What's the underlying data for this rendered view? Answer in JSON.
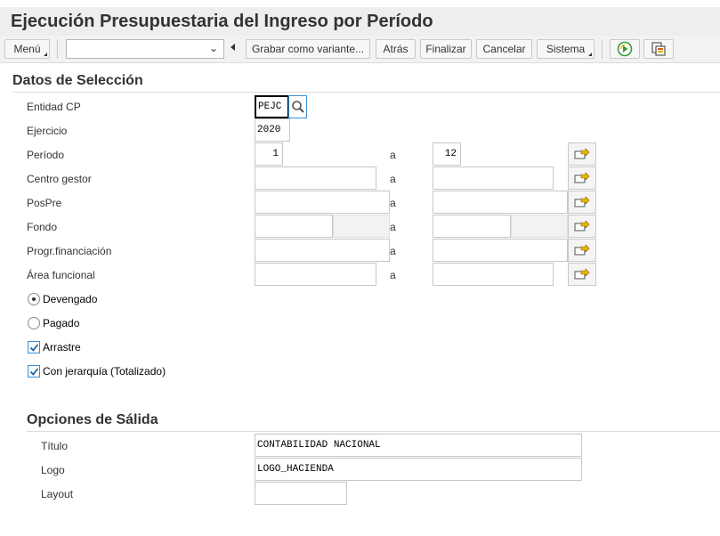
{
  "window": {
    "title": "Ejecución Presupuestaria del Ingreso por Período"
  },
  "toolbar": {
    "menu_label": "Menú",
    "command_field_value": "",
    "save_variant_label": "Grabar como variante...",
    "back_label": "Atrás",
    "exit_label": "Finalizar",
    "cancel_label": "Cancelar",
    "system_label": "Sistema",
    "execute_icon": "execute-icon",
    "variant_icon": "get-variant-icon"
  },
  "selection": {
    "heading": "Datos de Selección",
    "to_label": "a",
    "fields": [
      {
        "label": "Entidad CP",
        "low": "PEJC",
        "high": null
      },
      {
        "label": "Ejercicio",
        "low": "2020",
        "high": null
      },
      {
        "label": "Período",
        "low": "1",
        "high": "12"
      },
      {
        "label": "Centro gestor",
        "low": "",
        "high": ""
      },
      {
        "label": "PosPre",
        "low": "",
        "high": ""
      },
      {
        "label": "Fondo",
        "low": "",
        "high": ""
      },
      {
        "label": "Progr.financiación",
        "low": "",
        "high": ""
      },
      {
        "label": "Área funcional",
        "low": "",
        "high": ""
      }
    ],
    "radios": [
      {
        "label": "Devengado",
        "checked": true
      },
      {
        "label": "Pagado",
        "checked": false
      }
    ],
    "checkboxes": [
      {
        "label": "Arrastre",
        "checked": true
      },
      {
        "label": "Con jerarquía (Totalizado)",
        "checked": true
      }
    ]
  },
  "output": {
    "heading": "Opciones de Sálida",
    "fields": [
      {
        "label": "Título",
        "value": "CONTABILIDAD NACIONAL"
      },
      {
        "label": "Logo",
        "value": "LOGO_HACIENDA"
      },
      {
        "label": "Layout",
        "value": ""
      }
    ]
  },
  "colors": {
    "accent": "#3a8fd6",
    "multiselect_arrow": "#e8b400",
    "execute_green": "#3a9a3a"
  }
}
